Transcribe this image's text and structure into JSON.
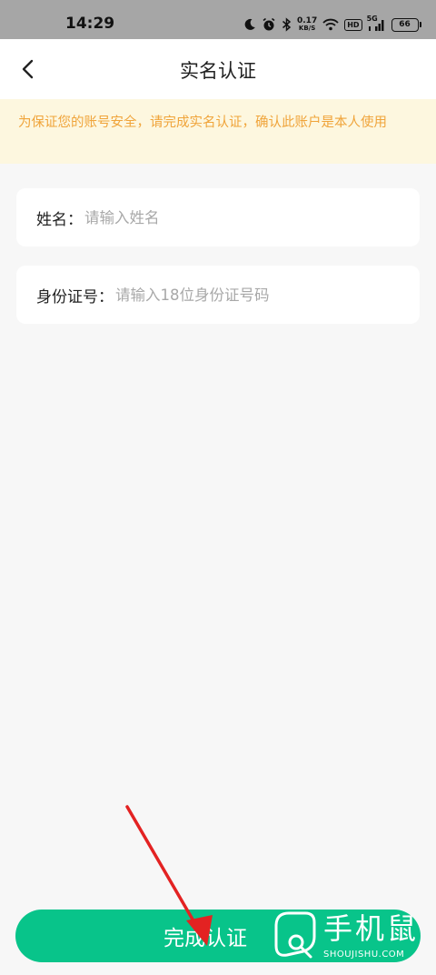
{
  "status_bar": {
    "time": "14:29",
    "net_speed_value": "0.17",
    "net_speed_unit": "KB/S",
    "hd_label": "HD",
    "network_label": "5G",
    "battery_level": "66",
    "icons": [
      "moon-icon",
      "alarm-icon",
      "bluetooth-icon",
      "wifi-icon",
      "signal-icon",
      "battery-icon"
    ]
  },
  "header": {
    "title": "实名认证",
    "back_icon": "chevron-left-icon"
  },
  "notice": {
    "text": "为保证您的账号安全，请完成实名认证，确认此账户是本人使用",
    "color": "#f0a43a",
    "background": "#fdf7df"
  },
  "form": {
    "name": {
      "label": "姓名：",
      "value": "",
      "placeholder": "请输入姓名"
    },
    "id_number": {
      "label": "身份证号：",
      "value": "",
      "placeholder": "请输入18位身份证号码"
    }
  },
  "submit": {
    "label": "完成认证",
    "color": "#08c48a"
  },
  "annotation": {
    "type": "arrow",
    "color": "#e32222"
  },
  "watermark": {
    "text": "手机鼠",
    "subtext": "SHOUJISHU.COM"
  }
}
